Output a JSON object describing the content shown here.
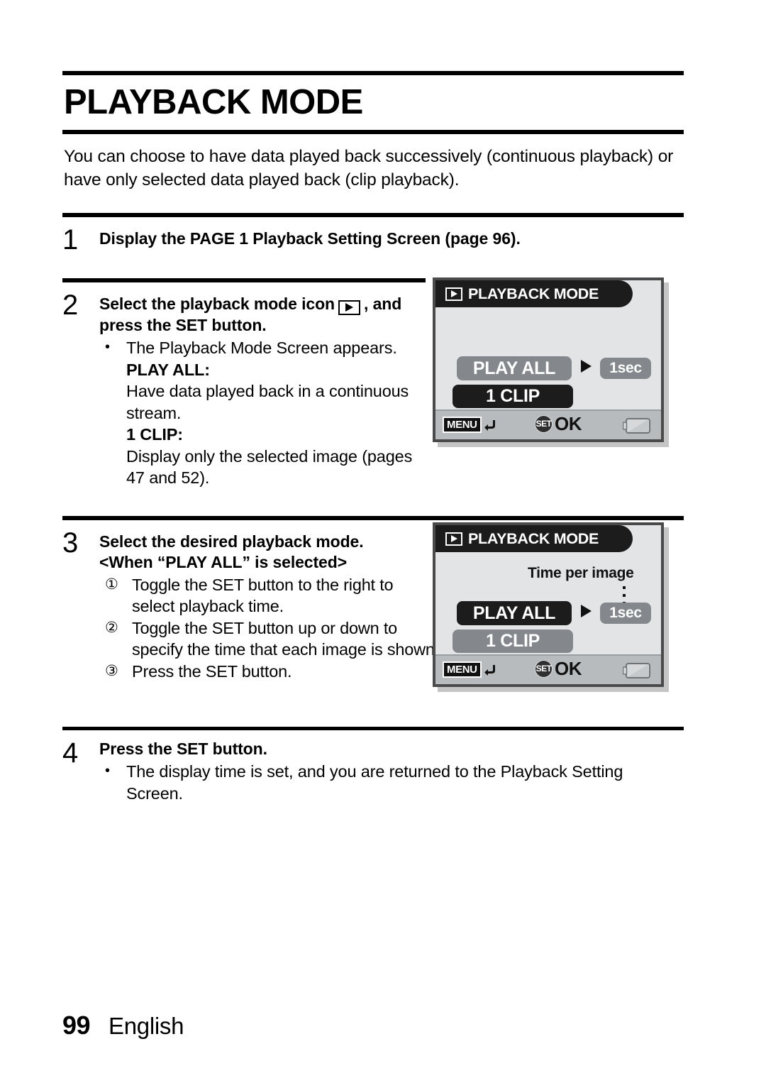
{
  "document": {
    "title": "PLAYBACK MODE",
    "intro": "You can choose to have data played back successively (continuous playback) or have only selected data played back (clip playback)."
  },
  "steps": [
    {
      "number": "1",
      "heading": "Display the PAGE 1 Playback Setting Screen (page 96)."
    },
    {
      "number": "2",
      "heading_part1": "Select the playback mode icon",
      "heading_part2": ", and press the SET button.",
      "bullet": "The Playback Mode Screen appears.",
      "term1": "PLAY ALL:",
      "desc1": "Have data played back in a continuous stream.",
      "term2": "1 CLIP:",
      "desc2": "Display only the selected image (pages 47 and 52)."
    },
    {
      "number": "3",
      "heading_line1": "Select the desired playback mode.",
      "heading_line2": "<When “PLAY ALL” is selected>",
      "items": [
        {
          "marker": "①",
          "text": "Toggle the SET button to the right to select playback time."
        },
        {
          "marker": "②",
          "text": "Toggle the SET button up or down to specify the time that each image is shown."
        },
        {
          "marker": "③",
          "text": "Press the SET button."
        }
      ]
    },
    {
      "number": "4",
      "heading": "Press the SET button.",
      "bullet": "The display time is set, and you are returned to the Playback Setting Screen."
    }
  ],
  "lcd_screens": [
    {
      "id": "screen-step2",
      "title": "PLAYBACK MODE",
      "title_icon": "play-icon",
      "play_all_label": "PLAY ALL",
      "play_all_state": "unselected",
      "clip_label": "1 CLIP",
      "clip_state": "selected",
      "time_value": "1sec",
      "time_annotation": null,
      "bottom_bar": {
        "menu_label": "MENU",
        "menu_icon": "return-arrow-icon",
        "set_label": "SET",
        "ok_label": "OK",
        "battery_icon": "battery-icon"
      }
    },
    {
      "id": "screen-step3",
      "title": "PLAYBACK MODE",
      "title_icon": "play-icon",
      "play_all_label": "PLAY ALL",
      "play_all_state": "selected",
      "clip_label": "1 CLIP",
      "clip_state": "unselected",
      "time_value": "1sec",
      "time_annotation": "Time per image",
      "bottom_bar": {
        "menu_label": "MENU",
        "menu_icon": "return-arrow-icon",
        "set_label": "SET",
        "ok_label": "OK",
        "battery_icon": "battery-icon"
      }
    }
  ],
  "footer": {
    "page_number": "99",
    "language": "English"
  },
  "colors": {
    "selected_pill": "#1c1c1c",
    "unselected_pill": "#84888c",
    "lcd_background": "#e2e4e6",
    "lcd_bottom_bar": "#b8bbbe",
    "lcd_border": "#4a4a4a"
  }
}
